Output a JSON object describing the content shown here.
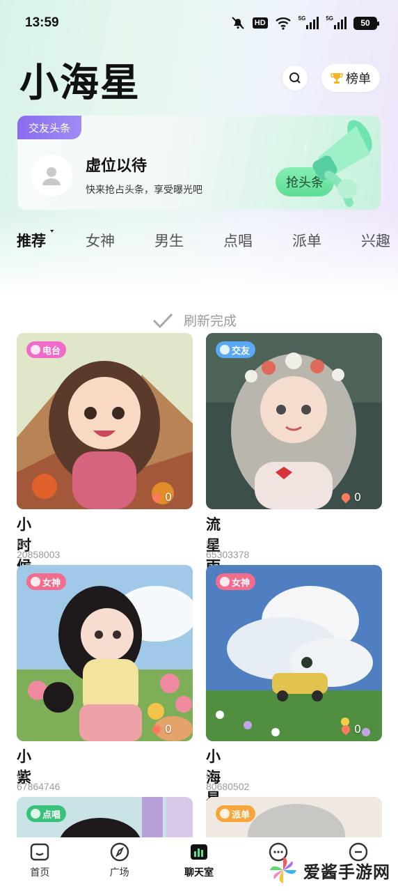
{
  "status_bar": {
    "time": "13:59",
    "hd_label": "HD",
    "signal1_label": "5G",
    "signal2_label": "5G",
    "battery": "50"
  },
  "header": {
    "title": "小海星",
    "rank_label": "榜单"
  },
  "headline": {
    "tag": "交友头条",
    "title": "虚位以待",
    "subtitle": "快来抢占头条，享受曝光吧",
    "button_label": "抢头条"
  },
  "tabs": [
    {
      "label": "推荐",
      "active": true
    },
    {
      "label": "女神",
      "active": false
    },
    {
      "label": "男生",
      "active": false
    },
    {
      "label": "点唱",
      "active": false
    },
    {
      "label": "派单",
      "active": false
    },
    {
      "label": "兴趣",
      "active": false
    }
  ],
  "refresh_text": "刷新完成",
  "rooms": [
    {
      "name": "小时候的天很蓝",
      "id": "ID: 20858003",
      "category": "电台",
      "likes": "0",
      "badge_color": "#f06bc9"
    },
    {
      "name": "流星雨",
      "id": "ID: 65303378",
      "category": "交友",
      "likes": "0",
      "badge_color": "#5aa9f5"
    },
    {
      "name": "小紫",
      "id": "ID: 67864746",
      "category": "女神",
      "likes": "0",
      "badge_color": "#f26d8d"
    },
    {
      "name": "小海星",
      "id": "ID: 80680502",
      "category": "女神",
      "likes": "0",
      "badge_color": "#f26d8d"
    },
    {
      "name": "",
      "id": "",
      "category": "点唱",
      "likes": "",
      "badge_color": "#39c27a"
    },
    {
      "name": "",
      "id": "",
      "category": "派单",
      "likes": "",
      "badge_color": "#f7a63b"
    }
  ],
  "bottom_nav": [
    {
      "label": "首页",
      "icon": "home-icon",
      "active": false
    },
    {
      "label": "广场",
      "icon": "compass-icon",
      "active": false
    },
    {
      "label": "聊天室",
      "icon": "chatroom-icon",
      "active": true
    },
    {
      "label": "",
      "icon": "message-icon",
      "active": false
    },
    {
      "label": "",
      "icon": "profile-icon",
      "active": false
    }
  ],
  "watermark": "爱酱手游网",
  "colors": {
    "accent_purple": "#8a6cf0",
    "accent_green": "#5fdc95"
  }
}
